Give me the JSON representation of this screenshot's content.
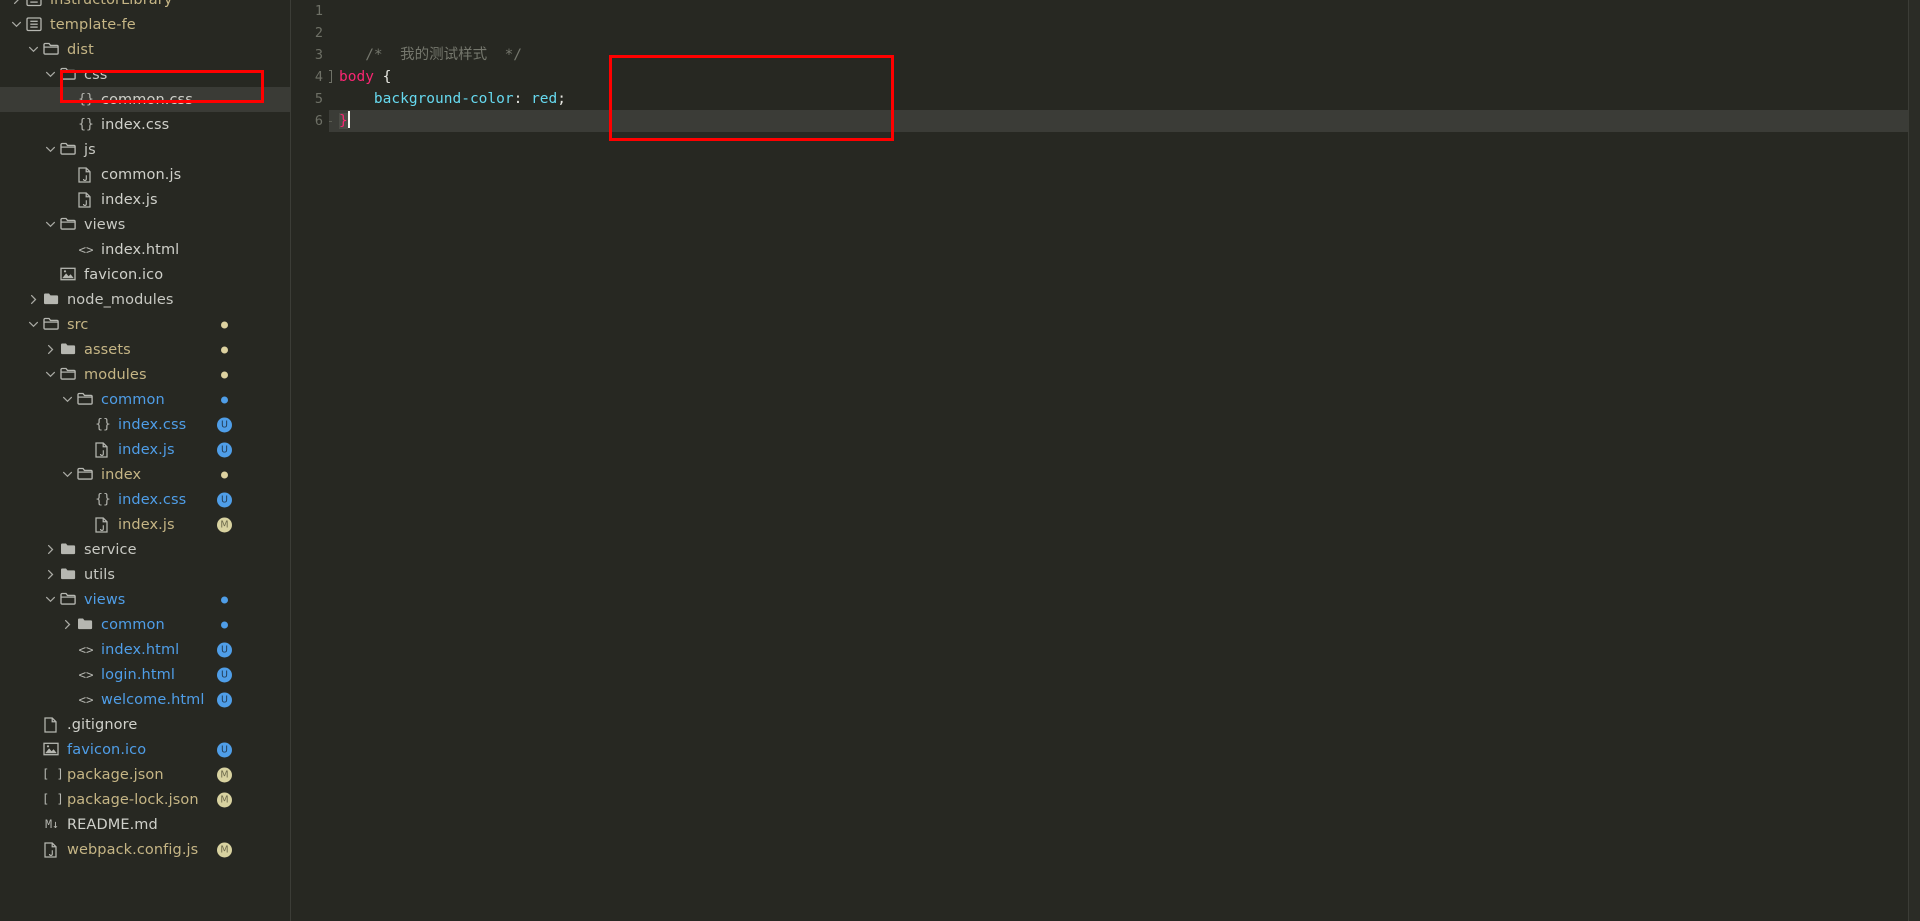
{
  "app": {
    "theme_bg": "#272822",
    "accent": "#4f9ee8",
    "annotation_color": "#ff0000"
  },
  "sidebar": {
    "name": "explorer-tree",
    "rows": [
      {
        "label": "instructorLibrary",
        "indent": 0,
        "twisty": "chevron-right",
        "icon": "project-icon",
        "color": "c-yellow",
        "badge": null,
        "selected": false,
        "clipped": true
      },
      {
        "label": "template-fe",
        "indent": 0,
        "twisty": "chevron-down",
        "icon": "project-icon",
        "color": "c-yellow",
        "badge": null,
        "selected": false
      },
      {
        "label": "dist",
        "indent": 1,
        "twisty": "chevron-down",
        "icon": "folder-open-icon",
        "color": "c-yellow",
        "badge": null,
        "selected": false
      },
      {
        "label": "css",
        "indent": 2,
        "twisty": "chevron-down",
        "icon": "folder-open-icon",
        "color": "c-grey",
        "badge": null,
        "selected": false
      },
      {
        "label": "common.css",
        "indent": 3,
        "twisty": "none",
        "icon": "css-icon",
        "color": "c-white",
        "badge": null,
        "selected": true
      },
      {
        "label": "index.css",
        "indent": 3,
        "twisty": "none",
        "icon": "css-icon",
        "color": "c-white",
        "badge": null,
        "selected": false
      },
      {
        "label": "js",
        "indent": 2,
        "twisty": "chevron-down",
        "icon": "folder-open-icon",
        "color": "c-grey",
        "badge": null,
        "selected": false
      },
      {
        "label": "common.js",
        "indent": 3,
        "twisty": "none",
        "icon": "js-icon",
        "color": "c-white",
        "badge": null,
        "selected": false
      },
      {
        "label": "index.js",
        "indent": 3,
        "twisty": "none",
        "icon": "js-icon",
        "color": "c-white",
        "badge": null,
        "selected": false
      },
      {
        "label": "views",
        "indent": 2,
        "twisty": "chevron-down",
        "icon": "folder-open-icon",
        "color": "c-grey",
        "badge": null,
        "selected": false
      },
      {
        "label": "index.html",
        "indent": 3,
        "twisty": "none",
        "icon": "html-icon",
        "color": "c-white",
        "badge": null,
        "selected": false
      },
      {
        "label": "favicon.ico",
        "indent": 2,
        "twisty": "none",
        "icon": "image-icon",
        "color": "c-white",
        "badge": null,
        "selected": false
      },
      {
        "label": "node_modules",
        "indent": 1,
        "twisty": "chevron-right",
        "icon": "folder-icon",
        "color": "c-grey",
        "badge": null,
        "selected": false
      },
      {
        "label": "src",
        "indent": 1,
        "twisty": "chevron-down",
        "icon": "folder-open-icon",
        "color": "c-yellow",
        "badge": "dot-yellow",
        "selected": false
      },
      {
        "label": "assets",
        "indent": 2,
        "twisty": "chevron-right",
        "icon": "folder-icon",
        "color": "c-yellow",
        "badge": "dot-yellow",
        "selected": false
      },
      {
        "label": "modules",
        "indent": 2,
        "twisty": "chevron-down",
        "icon": "folder-open-icon",
        "color": "c-yellow",
        "badge": "dot-yellow",
        "selected": false
      },
      {
        "label": "common",
        "indent": 3,
        "twisty": "chevron-down",
        "icon": "folder-open-icon",
        "color": "c-blue",
        "badge": "dot-blue",
        "selected": false
      },
      {
        "label": "index.css",
        "indent": 4,
        "twisty": "none",
        "icon": "css-icon",
        "color": "c-blue",
        "badge": "U",
        "selected": false
      },
      {
        "label": "index.js",
        "indent": 4,
        "twisty": "none",
        "icon": "js-icon",
        "color": "c-blue",
        "badge": "U",
        "selected": false
      },
      {
        "label": "index",
        "indent": 3,
        "twisty": "chevron-down",
        "icon": "folder-open-icon",
        "color": "c-yellow",
        "badge": "dot-yellow",
        "selected": false
      },
      {
        "label": "index.css",
        "indent": 4,
        "twisty": "none",
        "icon": "css-icon",
        "color": "c-blue",
        "badge": "U",
        "selected": false
      },
      {
        "label": "index.js",
        "indent": 4,
        "twisty": "none",
        "icon": "js-icon",
        "color": "c-yellow",
        "badge": "M",
        "selected": false
      },
      {
        "label": "service",
        "indent": 2,
        "twisty": "chevron-right",
        "icon": "folder-icon",
        "color": "c-grey",
        "badge": null,
        "selected": false
      },
      {
        "label": "utils",
        "indent": 2,
        "twisty": "chevron-right",
        "icon": "folder-icon",
        "color": "c-grey",
        "badge": null,
        "selected": false
      },
      {
        "label": "views",
        "indent": 2,
        "twisty": "chevron-down",
        "icon": "folder-open-icon",
        "color": "c-blue",
        "badge": "dot-blue",
        "selected": false
      },
      {
        "label": "common",
        "indent": 3,
        "twisty": "chevron-right",
        "icon": "folder-icon",
        "color": "c-blue",
        "badge": "dot-blue",
        "selected": false
      },
      {
        "label": "index.html",
        "indent": 3,
        "twisty": "none",
        "icon": "html-icon",
        "color": "c-blue",
        "badge": "U",
        "selected": false
      },
      {
        "label": "login.html",
        "indent": 3,
        "twisty": "none",
        "icon": "html-icon",
        "color": "c-blue",
        "badge": "U",
        "selected": false
      },
      {
        "label": "welcome.html",
        "indent": 3,
        "twisty": "none",
        "icon": "html-icon",
        "color": "c-blue",
        "badge": "U",
        "selected": false
      },
      {
        "label": ".gitignore",
        "indent": 1,
        "twisty": "none",
        "icon": "file-icon",
        "color": "c-white",
        "badge": null,
        "selected": false
      },
      {
        "label": "favicon.ico",
        "indent": 1,
        "twisty": "none",
        "icon": "image-icon",
        "color": "c-blue",
        "badge": "U",
        "selected": false
      },
      {
        "label": "package.json",
        "indent": 1,
        "twisty": "none",
        "icon": "json-icon",
        "color": "c-yellow",
        "badge": "M",
        "selected": false
      },
      {
        "label": "package-lock.json",
        "indent": 1,
        "twisty": "none",
        "icon": "json-icon",
        "color": "c-yellow",
        "badge": "M",
        "selected": false
      },
      {
        "label": "README.md",
        "indent": 1,
        "twisty": "none",
        "icon": "markdown-icon",
        "color": "c-white",
        "badge": null,
        "selected": false
      },
      {
        "label": "webpack.config.js",
        "indent": 1,
        "twisty": "none",
        "icon": "js-icon",
        "color": "c-yellow",
        "badge": "M",
        "selected": false
      }
    ]
  },
  "editor": {
    "name": "code-editor",
    "line_numbers": [
      "1",
      "2",
      "3",
      "4",
      "5",
      "6"
    ],
    "active_line": 6,
    "lines": [
      {
        "n": 1,
        "tokens": []
      },
      {
        "n": 2,
        "tokens": []
      },
      {
        "n": 3,
        "tokens": [
          {
            "t": "comment",
            "s": "   /*  我的测试样式  */"
          }
        ]
      },
      {
        "n": 4,
        "fold": "-",
        "tokens": [
          {
            "t": "sel",
            "s": "body"
          },
          {
            "t": "plain",
            "s": " "
          },
          {
            "t": "brace",
            "s": "{"
          }
        ]
      },
      {
        "n": 5,
        "guide": true,
        "tokens": [
          {
            "t": "plain",
            "s": "    "
          },
          {
            "t": "prop",
            "s": "background-color"
          },
          {
            "t": "colon",
            "s": ":"
          },
          {
            "t": "plain",
            "s": " "
          },
          {
            "t": "val",
            "s": "red"
          },
          {
            "t": "semi",
            "s": ";"
          }
        ]
      },
      {
        "n": 6,
        "guide": "corner",
        "tokens": [
          {
            "t": "brace-hl",
            "s": "}"
          }
        ],
        "caret": true
      }
    ]
  },
  "annotations": [
    {
      "name": "annotation-common-css",
      "target": "common.css tree row"
    },
    {
      "name": "annotation-css-rule",
      "target": "body { background-color: red; }"
    }
  ]
}
